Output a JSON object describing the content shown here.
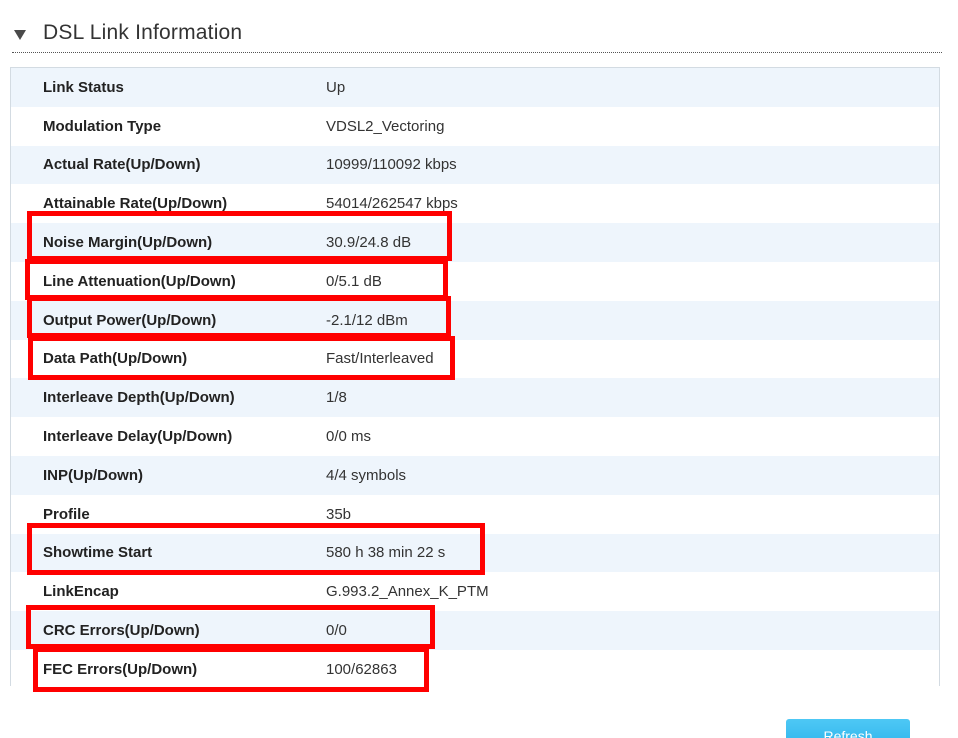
{
  "section": {
    "title": "DSL Link Information"
  },
  "rows": [
    {
      "label": "Link Status",
      "value": "Up"
    },
    {
      "label": "Modulation Type",
      "value": "VDSL2_Vectoring"
    },
    {
      "label": "Actual Rate(Up/Down)",
      "value": "10999/110092 kbps"
    },
    {
      "label": "Attainable Rate(Up/Down)",
      "value": "54014/262547 kbps"
    },
    {
      "label": "Noise Margin(Up/Down)",
      "value": "30.9/24.8 dB"
    },
    {
      "label": "Line Attenuation(Up/Down)",
      "value": "0/5.1 dB"
    },
    {
      "label": "Output Power(Up/Down)",
      "value": "-2.1/12 dBm"
    },
    {
      "label": "Data Path(Up/Down)",
      "value": "Fast/Interleaved"
    },
    {
      "label": "Interleave Depth(Up/Down)",
      "value": "1/8"
    },
    {
      "label": "Interleave Delay(Up/Down)",
      "value": "0/0 ms"
    },
    {
      "label": "INP(Up/Down)",
      "value": "4/4 symbols"
    },
    {
      "label": "Profile",
      "value": "35b"
    },
    {
      "label": "Showtime Start",
      "value": "580 h 38 min 22 s"
    },
    {
      "label": "LinkEncap",
      "value": "G.993.2_Annex_K_PTM"
    },
    {
      "label": "CRC Errors(Up/Down)",
      "value": "0/0"
    },
    {
      "label": "FEC Errors(Up/Down)",
      "value": "100/62863"
    }
  ],
  "buttons": {
    "refresh_label": "Refresh"
  },
  "colors": {
    "highlight": "#ff0000",
    "row_alt": "#eef5fc",
    "button": "#23aee8"
  }
}
